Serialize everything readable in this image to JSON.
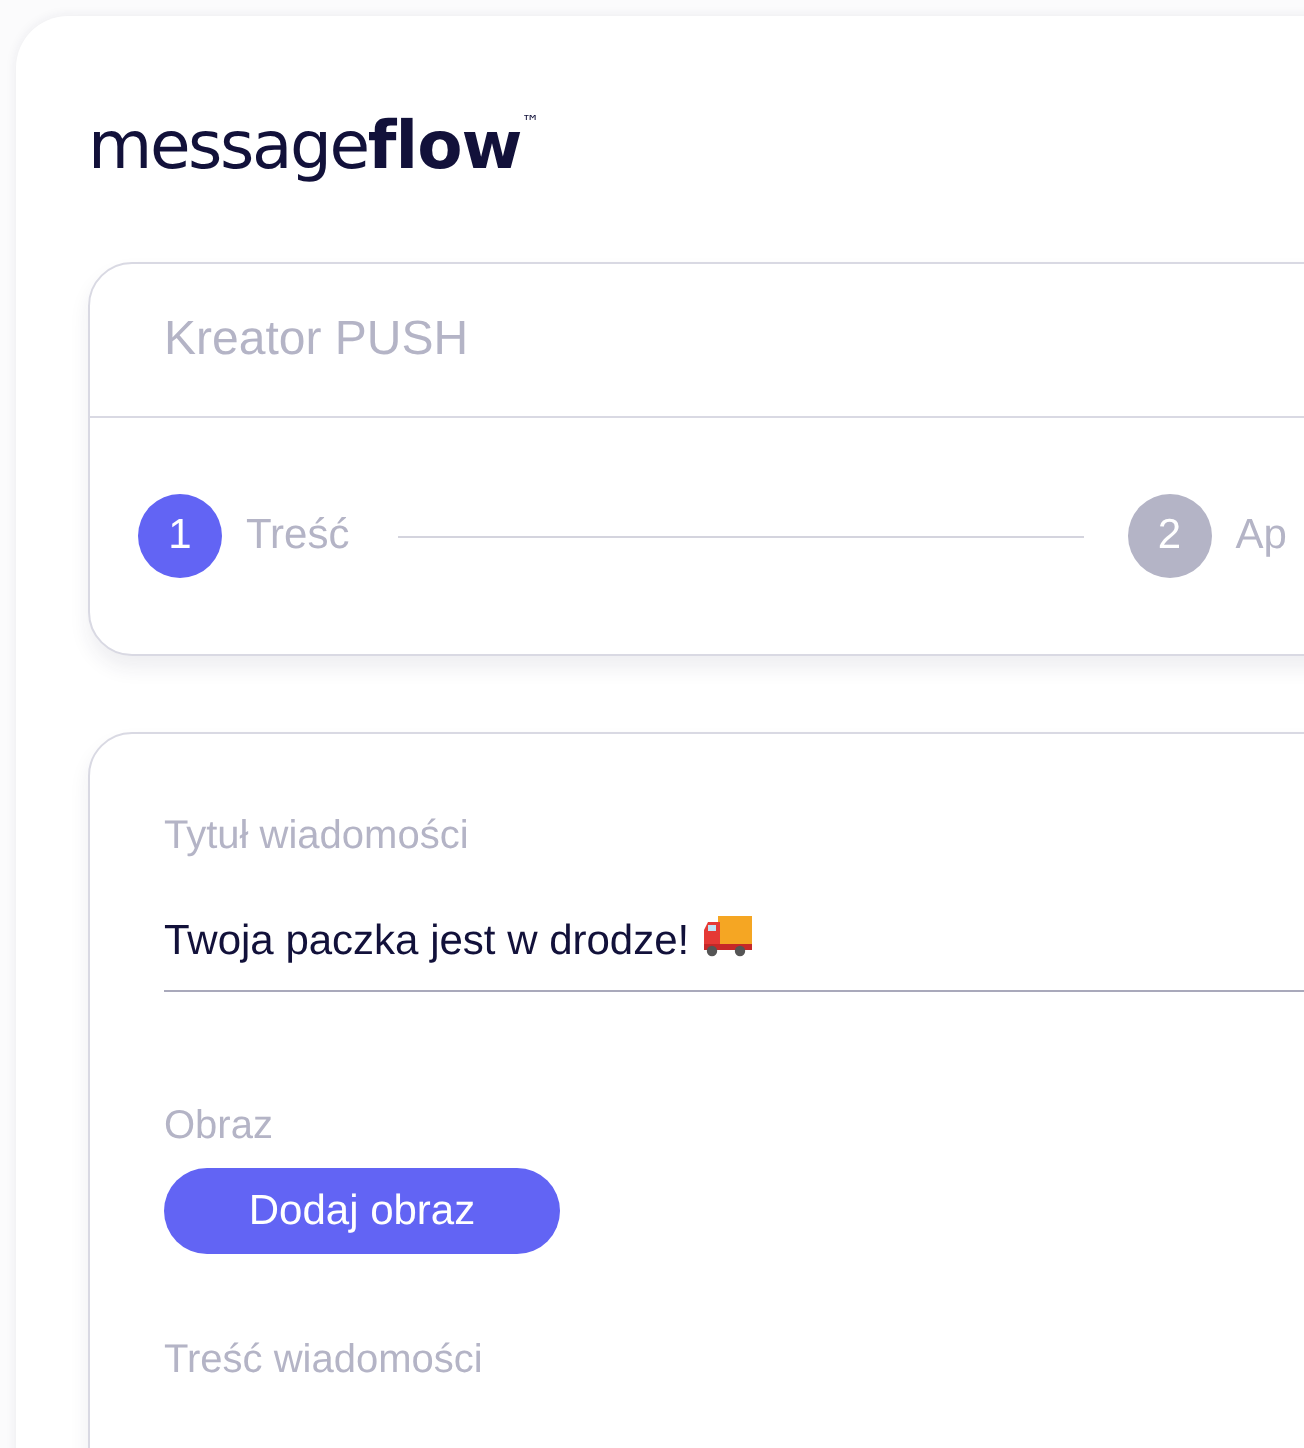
{
  "logo": {
    "text": "message**flow**$^{™}$"
  },
  "creator": {
    "title": "Kreator PUSH",
    "steps": [
      {
        "number": "1",
        "label": "Treść",
        "selected": true
      },
      {
        "number": "2",
        "label": "Ap",
        "selected": false
      }
    ]
  },
  "form": {
    "fields": [
      {
        "kind": "text",
        "label": "Tytuł wiadomości",
        "value": "Twoja paczka jest w drodze!"
      },
      {
        "kind": "image",
        "label": "Obraz",
        "button": "Dodaj obraz"
      },
      {
        "kind": "label",
        "label": "Treść wiadomości"
      }
    ]
  }
}
